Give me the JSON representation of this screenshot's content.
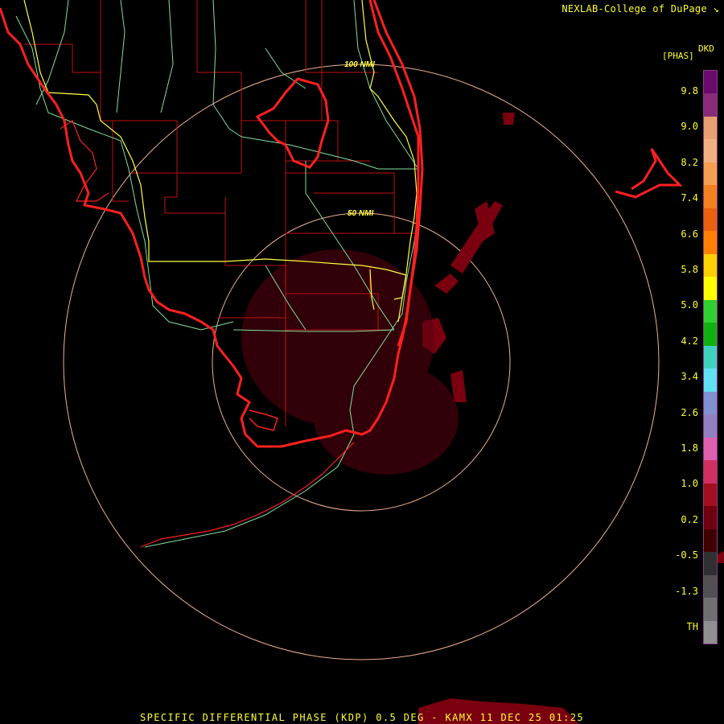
{
  "header": {
    "credit": "NEXLAB-College of DuPage"
  },
  "legend": {
    "product": "DKD",
    "unit": "[PHAS]",
    "ticks": [
      "9.8",
      "9.0",
      "8.2",
      "7.4",
      "6.6",
      "5.8",
      "5.0",
      "4.2",
      "3.4",
      "2.6",
      "1.8",
      "1.0",
      "0.2",
      "-0.5",
      "-1.3",
      "TH"
    ],
    "colors": [
      "#6a0a6a",
      "#8a2a7a",
      "#e8a070",
      "#f0b080",
      "#f5a050",
      "#f08020",
      "#e86010",
      "#ff8000",
      "#ffd000",
      "#ffff00",
      "#30d030",
      "#10b010",
      "#40d0c0",
      "#60e0f0",
      "#8090d0",
      "#9080c0",
      "#e060b0",
      "#d03060",
      "#a01020",
      "#700010",
      "#400000",
      "#303030",
      "#505050",
      "#707070",
      "#909090"
    ]
  },
  "range_rings": [
    {
      "label": "100 NMI"
    },
    {
      "label": "50 NMI"
    }
  ],
  "footer": {
    "caption": "SPECIFIC DIFFERENTIAL PHASE (KDP) 0.5 DEG - KAMX 11 DEC 25 01:25"
  },
  "colors": {
    "coast": "#ff2020",
    "county": "#c01010",
    "road": "#80e0a0",
    "highway": "#ffff40",
    "ring": "#f0b090",
    "echo": "#7a0010"
  }
}
